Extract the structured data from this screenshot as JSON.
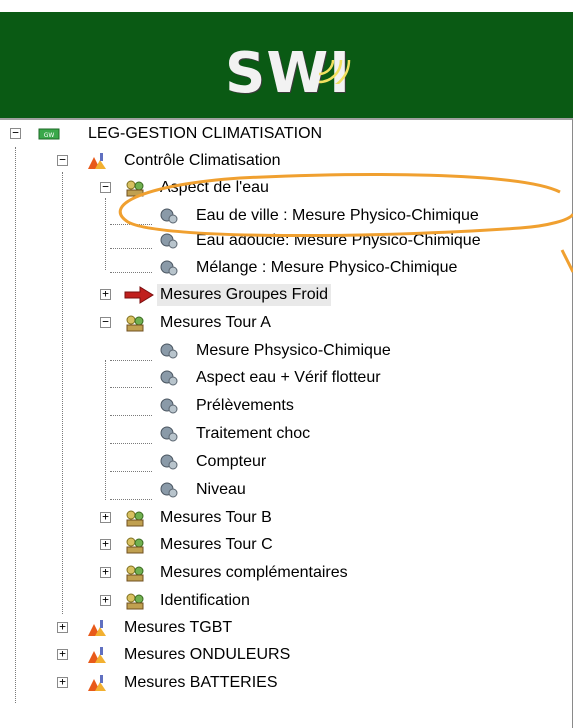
{
  "banner": {
    "logo_text": "SWI"
  },
  "tree": {
    "root": {
      "label": "LEG-GESTION CLIMATISATION",
      "icon": "red-tag-icon"
    },
    "nodes": [
      {
        "label": "Contrôle Climatisation",
        "icon": "site-icon"
      },
      {
        "label": "Aspect de l'eau",
        "icon": "group-icon"
      },
      {
        "label": "Eau de ville : Mesure Physico-Chimique",
        "icon": "measure-icon"
      },
      {
        "label": "Eau adoucie: Mesure Physico-Chimique",
        "icon": "measure-icon"
      },
      {
        "label": "Mélange : Mesure Physico-Chimique",
        "icon": "measure-icon"
      },
      {
        "label": "Mesures  Groupes Froid",
        "icon": "red-arrow-icon"
      },
      {
        "label": "Mesures Tour A",
        "icon": "group-icon"
      },
      {
        "label": "Mesure Phsysico-Chimique",
        "icon": "measure-icon"
      },
      {
        "label": "Aspect eau + Vérif flotteur",
        "icon": "measure-icon"
      },
      {
        "label": "Prélèvements",
        "icon": "measure-icon"
      },
      {
        "label": "Traitement choc",
        "icon": "measure-icon"
      },
      {
        "label": "Compteur",
        "icon": "measure-icon"
      },
      {
        "label": "Niveau",
        "icon": "measure-icon"
      },
      {
        "label": "Mesures Tour B",
        "icon": "group-icon"
      },
      {
        "label": "Mesures Tour C",
        "icon": "group-icon"
      },
      {
        "label": "Mesures complémentaires",
        "icon": "group-icon"
      },
      {
        "label": "Identification",
        "icon": "group-icon"
      },
      {
        "label": "Mesures TGBT",
        "icon": "site-icon"
      },
      {
        "label": "Mesures ONDULEURS",
        "icon": "site-icon"
      },
      {
        "label": "Mesures BATTERIES",
        "icon": "site-icon"
      }
    ]
  },
  "colors": {
    "banner_green": "#0a5a14",
    "annotation_orange": "#f0a030",
    "arrow_red": "#c0201e"
  }
}
